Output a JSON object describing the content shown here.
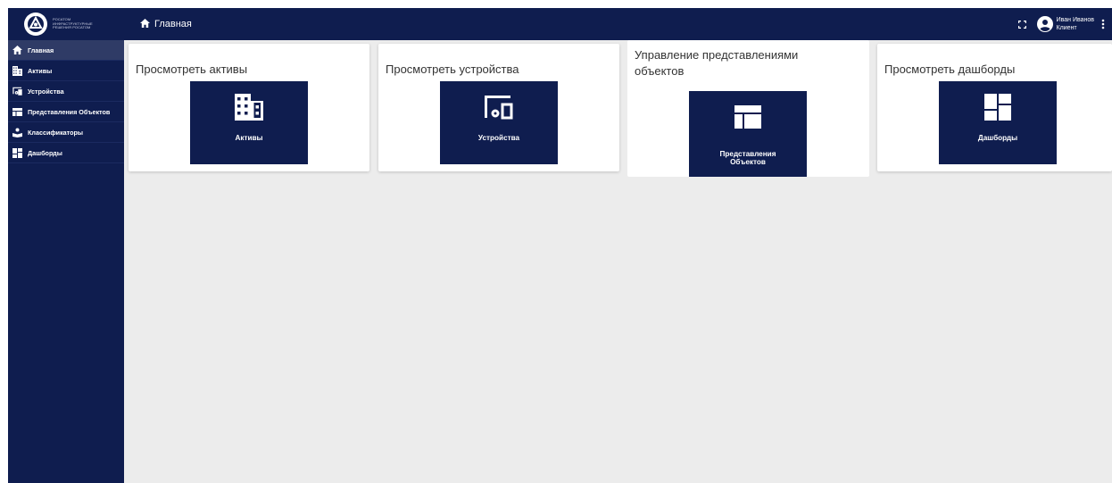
{
  "brand": {
    "logo_text": "РОСАТОМ ИНФРАСТРУКТУРНЫЕ РЕШЕНИЯ РОСАТОМ",
    "color": "#0f1d4f"
  },
  "header": {
    "breadcrumb": "Главная",
    "user_name": "Иван Иванов",
    "user_role": "Клиент"
  },
  "sidebar": {
    "items": [
      {
        "label": "Главная",
        "icon": "home-icon"
      },
      {
        "label": "Активы",
        "icon": "building-icon"
      },
      {
        "label": "Устройства",
        "icon": "devices-icon"
      },
      {
        "label": "Представления Объектов",
        "icon": "view-icon"
      },
      {
        "label": "Классификаторы",
        "icon": "classifier-icon"
      },
      {
        "label": "Дашборды",
        "icon": "dashboard-icon"
      }
    ]
  },
  "cards": [
    {
      "title": "Просмотреть активы",
      "tile_label": "Активы",
      "icon": "building-icon"
    },
    {
      "title": "Просмотреть устройства",
      "tile_label": "Устройства",
      "icon": "devices-icon"
    },
    {
      "title": "Управление представлениями объектов",
      "tile_label": "Представления Объектов",
      "icon": "view-icon"
    },
    {
      "title": "Просмотреть дашборды",
      "tile_label": "Дашборды",
      "icon": "dashboard-icon"
    }
  ]
}
